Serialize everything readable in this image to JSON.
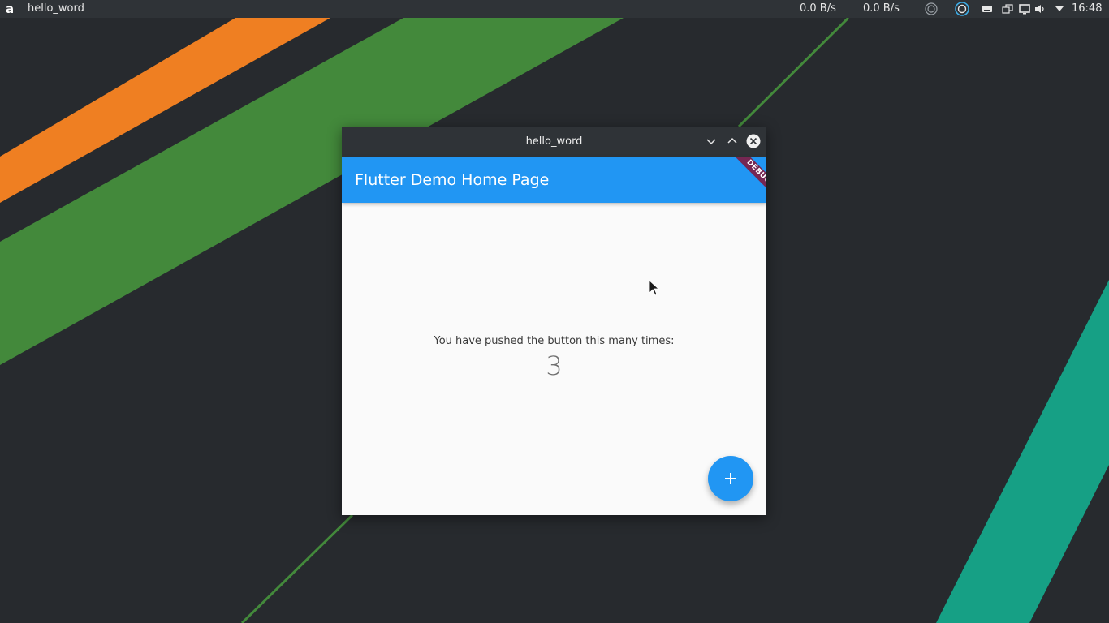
{
  "desktop": {
    "colors": {
      "background": "#272a2e",
      "stripe_orange": "#ef7f22",
      "stripe_green": "#43893b",
      "stripe_teal": "#16a085"
    }
  },
  "panel": {
    "launcher_glyph": "a",
    "active_window_title": "hello_word",
    "net_down": "0.0 B/s",
    "net_up": "0.0 B/s",
    "tray_icons": [
      "circle-icon",
      "network-icon",
      "keyboard-icon",
      "display-icon",
      "screen-icon",
      "volume-icon",
      "dropdown-arrow-icon"
    ],
    "clock": "16:48"
  },
  "window": {
    "title": "hello_word",
    "appbar_title": "Flutter Demo Home Page",
    "debug_banner": "DEBUG",
    "counter_label": "You have pushed the button this many times:",
    "counter_value": "3",
    "fab_icon": "plus-icon",
    "colors": {
      "titlebar": "#2f3337",
      "primary": "#2196f3",
      "surface": "#fafafa",
      "debug_banner": "#851436"
    }
  }
}
